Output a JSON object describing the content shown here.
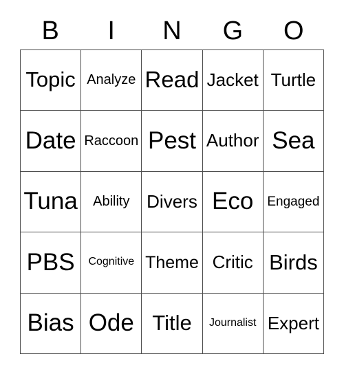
{
  "card": {
    "title": "BINGO",
    "columns": [
      "B",
      "I",
      "N",
      "G",
      "O"
    ],
    "rows": [
      [
        "Topic",
        "Analyze",
        "Read",
        "Jacket",
        "Turtle"
      ],
      [
        "Date",
        "Raccoon",
        "Pest",
        "Author",
        "Sea"
      ],
      [
        "Tuna",
        "Ability",
        "Divers",
        "Eco",
        "Engaged"
      ],
      [
        "PBS",
        "Cognitive",
        "Theme",
        "Critic",
        "Birds"
      ],
      [
        "Bias",
        "Ode",
        "Title",
        "Journalist",
        "Expert"
      ]
    ],
    "grid_size": "5x5",
    "colors": {
      "background": "#ffffff",
      "text": "#000000",
      "border": "#4d4d4d"
    }
  }
}
